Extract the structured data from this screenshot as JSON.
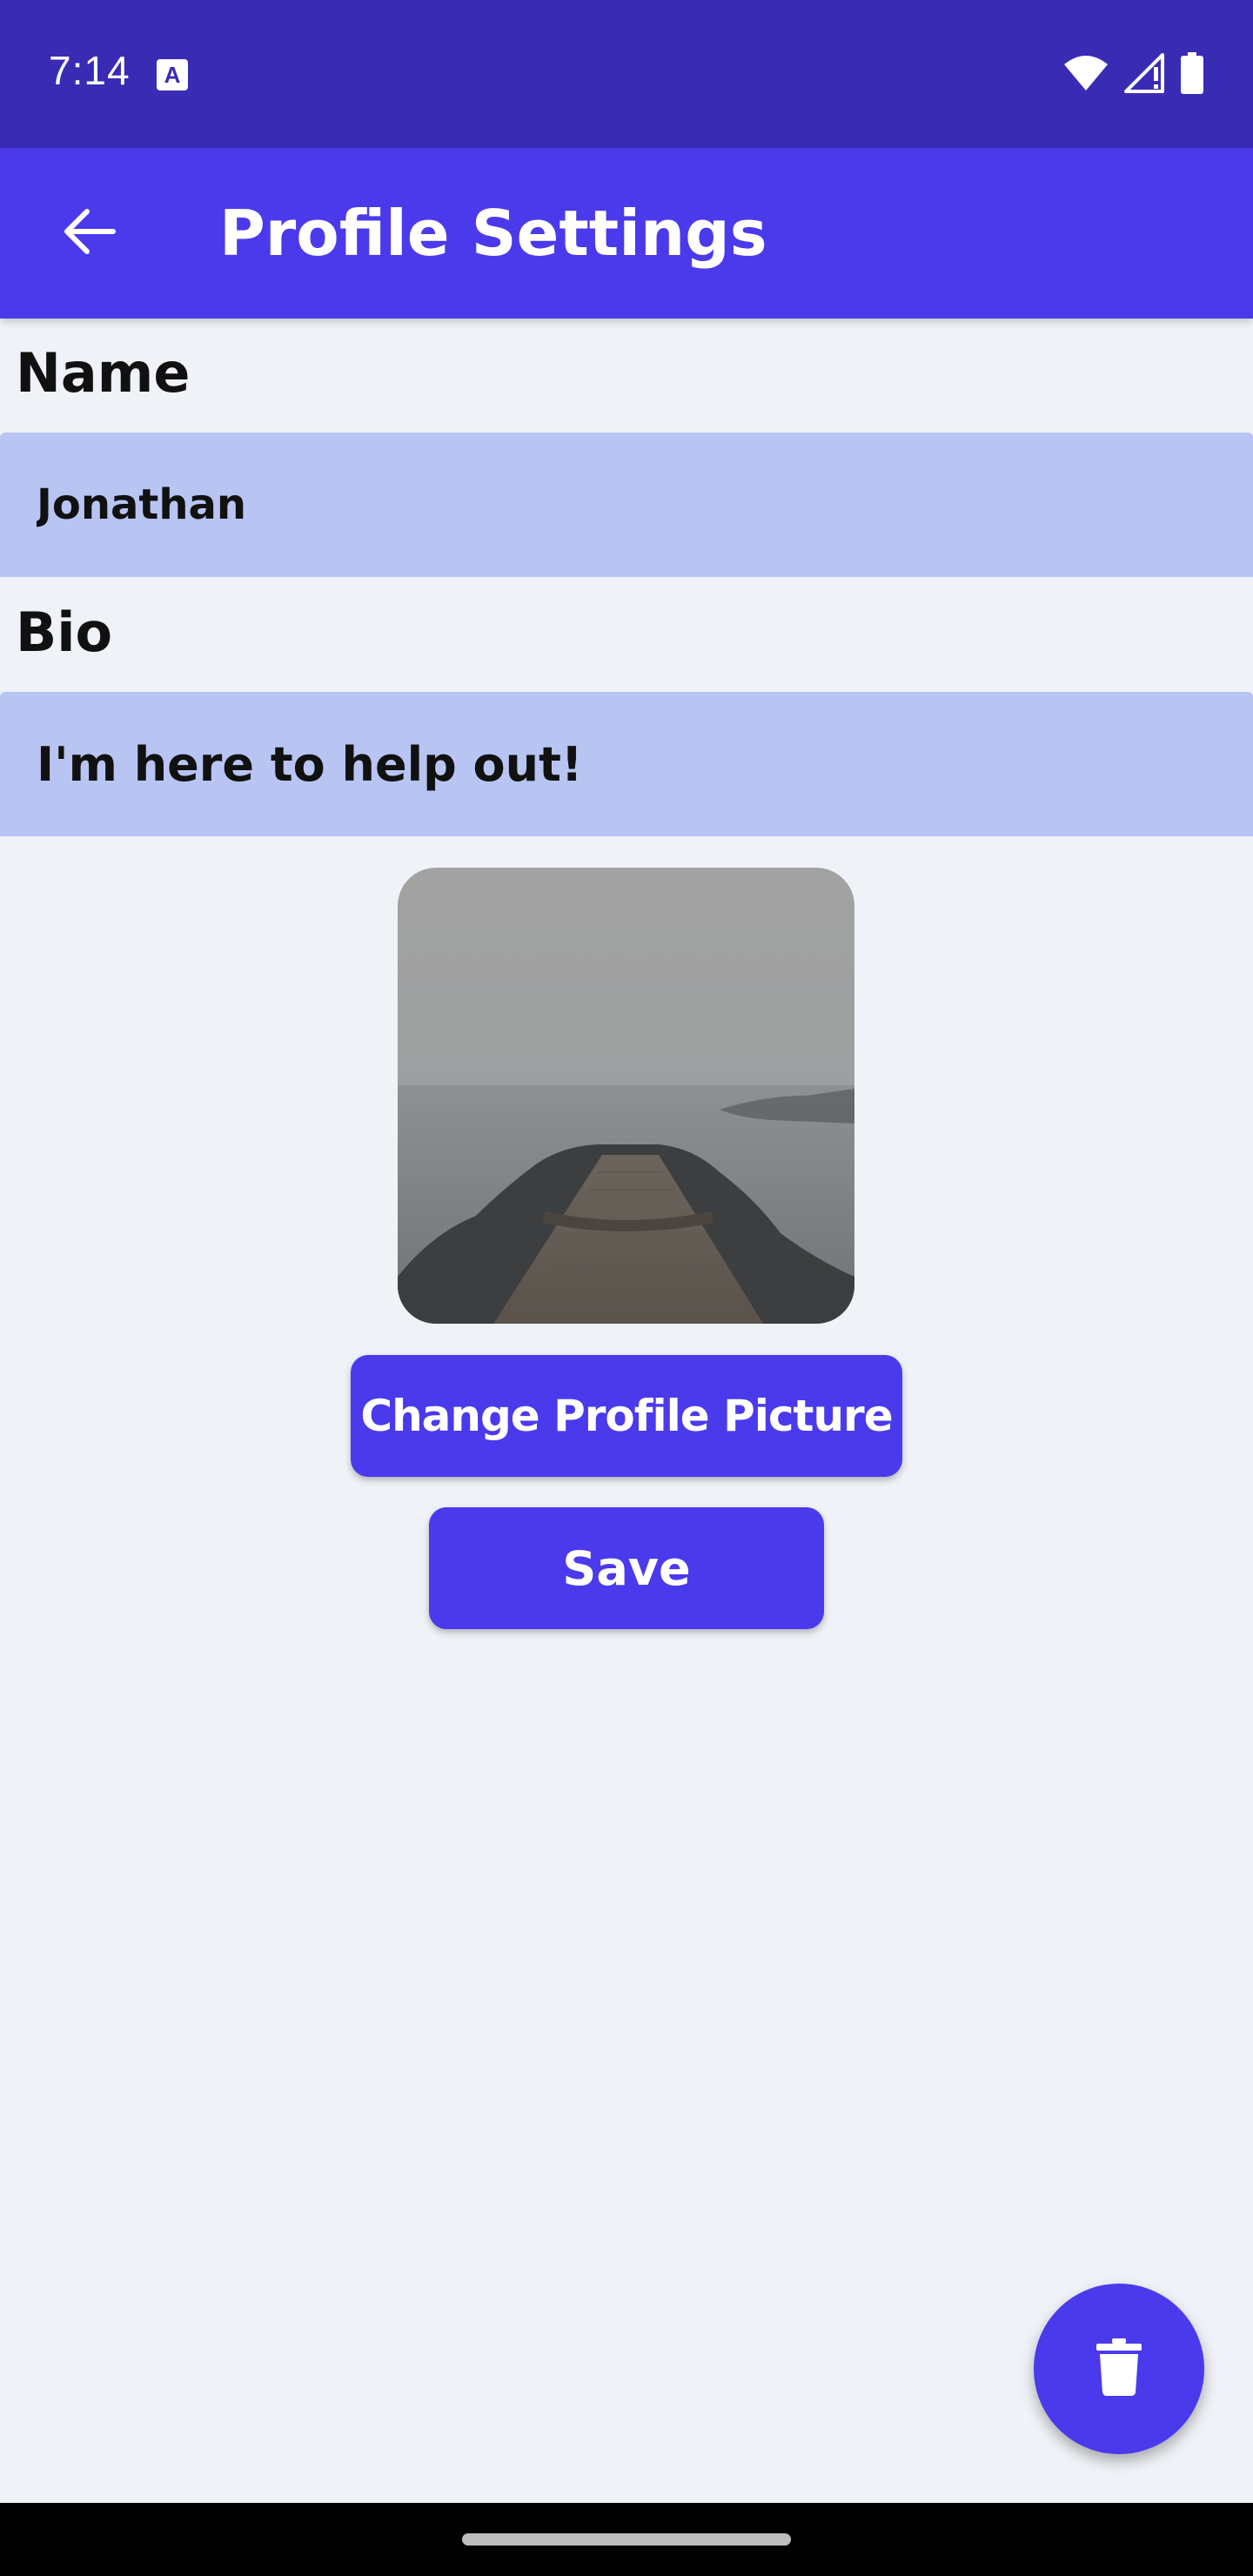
{
  "status_bar": {
    "time": "7:14",
    "keyboard_indicator": "A",
    "icons": [
      "wifi-icon",
      "signal-icon",
      "battery-icon"
    ]
  },
  "app_bar": {
    "title": "Profile Settings",
    "back_icon": "arrow-back-icon"
  },
  "form": {
    "name_label": "Name",
    "name_value": "Jonathan",
    "bio_label": "Bio",
    "bio_value": "I'm here to help out!"
  },
  "profile_picture": {
    "description_icon": "profile-photo"
  },
  "actions": {
    "change_picture_label": "Change Profile Picture",
    "save_label": "Save",
    "delete_icon": "trash-icon"
  },
  "colors": {
    "status_bar": "#3a2bb5",
    "primary": "#4b3aeb",
    "input_background": "#b8c4f2",
    "page_background": "#eff2f7"
  }
}
